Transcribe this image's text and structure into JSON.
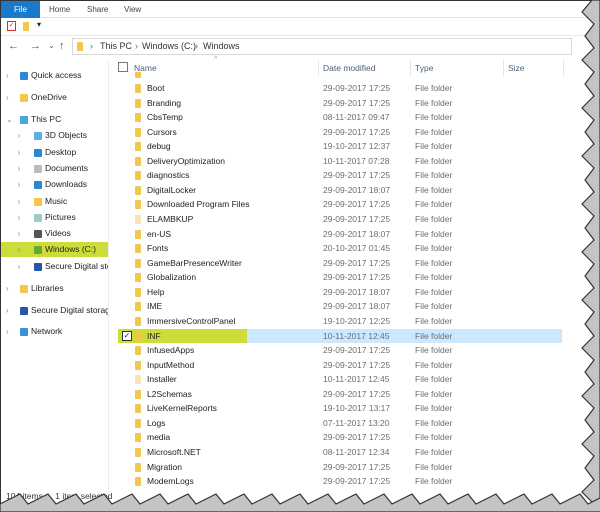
{
  "ribbon": {
    "tabs": [
      "File",
      "Home",
      "Share",
      "View"
    ]
  },
  "address": {
    "path": [
      "This PC",
      "Windows (C:)",
      "Windows"
    ],
    "sort_indicator": "^"
  },
  "nav_pane": {
    "items": [
      {
        "label": "Quick access",
        "icon": "star-icon",
        "level": 0,
        "expanded": false
      },
      {
        "label": "OneDrive",
        "icon": "folder-icon",
        "level": 0,
        "expanded": false
      },
      {
        "label": "This PC",
        "icon": "computer-icon",
        "level": 0,
        "expanded": true
      },
      {
        "label": "3D Objects",
        "icon": "3d-objects-icon",
        "level": 1
      },
      {
        "label": "Desktop",
        "icon": "desktop-icon",
        "level": 1
      },
      {
        "label": "Documents",
        "icon": "documents-icon",
        "level": 1
      },
      {
        "label": "Downloads",
        "icon": "downloads-icon",
        "level": 1
      },
      {
        "label": "Music",
        "icon": "music-icon",
        "level": 1
      },
      {
        "label": "Pictures",
        "icon": "pictures-icon",
        "level": 1
      },
      {
        "label": "Videos",
        "icon": "videos-icon",
        "level": 1
      },
      {
        "label": "Windows (C:)",
        "icon": "drive-icon",
        "level": 1,
        "selected": true
      },
      {
        "label": "Secure Digital storage",
        "icon": "sd-storage-icon",
        "level": 1
      },
      {
        "label": "Libraries",
        "icon": "libraries-icon",
        "level": 0
      },
      {
        "label": "Secure Digital storage",
        "icon": "sd-storage-icon",
        "level": 0
      },
      {
        "label": "Network",
        "icon": "network-icon",
        "level": 0
      }
    ]
  },
  "columns": {
    "name": "Name",
    "date": "Date modified",
    "type": "Type",
    "size": "Size"
  },
  "files": [
    {
      "name": "Boot",
      "date": "29-09-2017 17:25",
      "type": "File folder"
    },
    {
      "name": "Branding",
      "date": "29-09-2017 17:25",
      "type": "File folder"
    },
    {
      "name": "CbsTemp",
      "date": "08-11-2017 09:47",
      "type": "File folder"
    },
    {
      "name": "Cursors",
      "date": "29-09-2017 17:25",
      "type": "File folder"
    },
    {
      "name": "debug",
      "date": "19-10-2017 12:37",
      "type": "File folder"
    },
    {
      "name": "DeliveryOptimization",
      "date": "10-11-2017 07:28",
      "type": "File folder"
    },
    {
      "name": "diagnostics",
      "date": "29-09-2017 17:25",
      "type": "File folder"
    },
    {
      "name": "DigitalLocker",
      "date": "29-09-2017 18:07",
      "type": "File folder"
    },
    {
      "name": "Downloaded Program Files",
      "date": "29-09-2017 17:25",
      "type": "File folder"
    },
    {
      "name": "ELAMBKUP",
      "date": "29-09-2017 17:25",
      "type": "File folder"
    },
    {
      "name": "en-US",
      "date": "29-09-2017 18:07",
      "type": "File folder"
    },
    {
      "name": "Fonts",
      "date": "20-10-2017 01:45",
      "type": "File folder"
    },
    {
      "name": "GameBarPresenceWriter",
      "date": "29-09-2017 17:25",
      "type": "File folder"
    },
    {
      "name": "Globalization",
      "date": "29-09-2017 17:25",
      "type": "File folder"
    },
    {
      "name": "Help",
      "date": "29-09-2017 18:07",
      "type": "File folder"
    },
    {
      "name": "IME",
      "date": "29-09-2017 18:07",
      "type": "File folder"
    },
    {
      "name": "ImmersiveControlPanel",
      "date": "19-10-2017 12:25",
      "type": "File folder"
    },
    {
      "name": "INF",
      "date": "10-11-2017 12:45",
      "type": "File folder",
      "selected": true
    },
    {
      "name": "InfusedApps",
      "date": "29-09-2017 17:25",
      "type": "File folder"
    },
    {
      "name": "InputMethod",
      "date": "29-09-2017 17:25",
      "type": "File folder"
    },
    {
      "name": "Installer",
      "date": "10-11-2017 12:45",
      "type": "File folder"
    },
    {
      "name": "L2Schemas",
      "date": "29-09-2017 17:25",
      "type": "File folder"
    },
    {
      "name": "LiveKernelReports",
      "date": "19-10-2017 13:17",
      "type": "File folder"
    },
    {
      "name": "Logs",
      "date": "07-11-2017 13:20",
      "type": "File folder"
    },
    {
      "name": "media",
      "date": "29-09-2017 17:25",
      "type": "File folder"
    },
    {
      "name": "Microsoft.NET",
      "date": "08-11-2017 12:34",
      "type": "File folder"
    },
    {
      "name": "Migration",
      "date": "29-09-2017 17:25",
      "type": "File folder"
    },
    {
      "name": "ModemLogs",
      "date": "29-09-2017 17:25",
      "type": "File folder"
    }
  ],
  "status": {
    "count": "104 items",
    "selected": "1 item selected"
  },
  "colors": {
    "file_tab": "#1979ca",
    "highlight": "#cddc39",
    "row_selected": "#cce8ff",
    "folder": "#f3c84a"
  }
}
